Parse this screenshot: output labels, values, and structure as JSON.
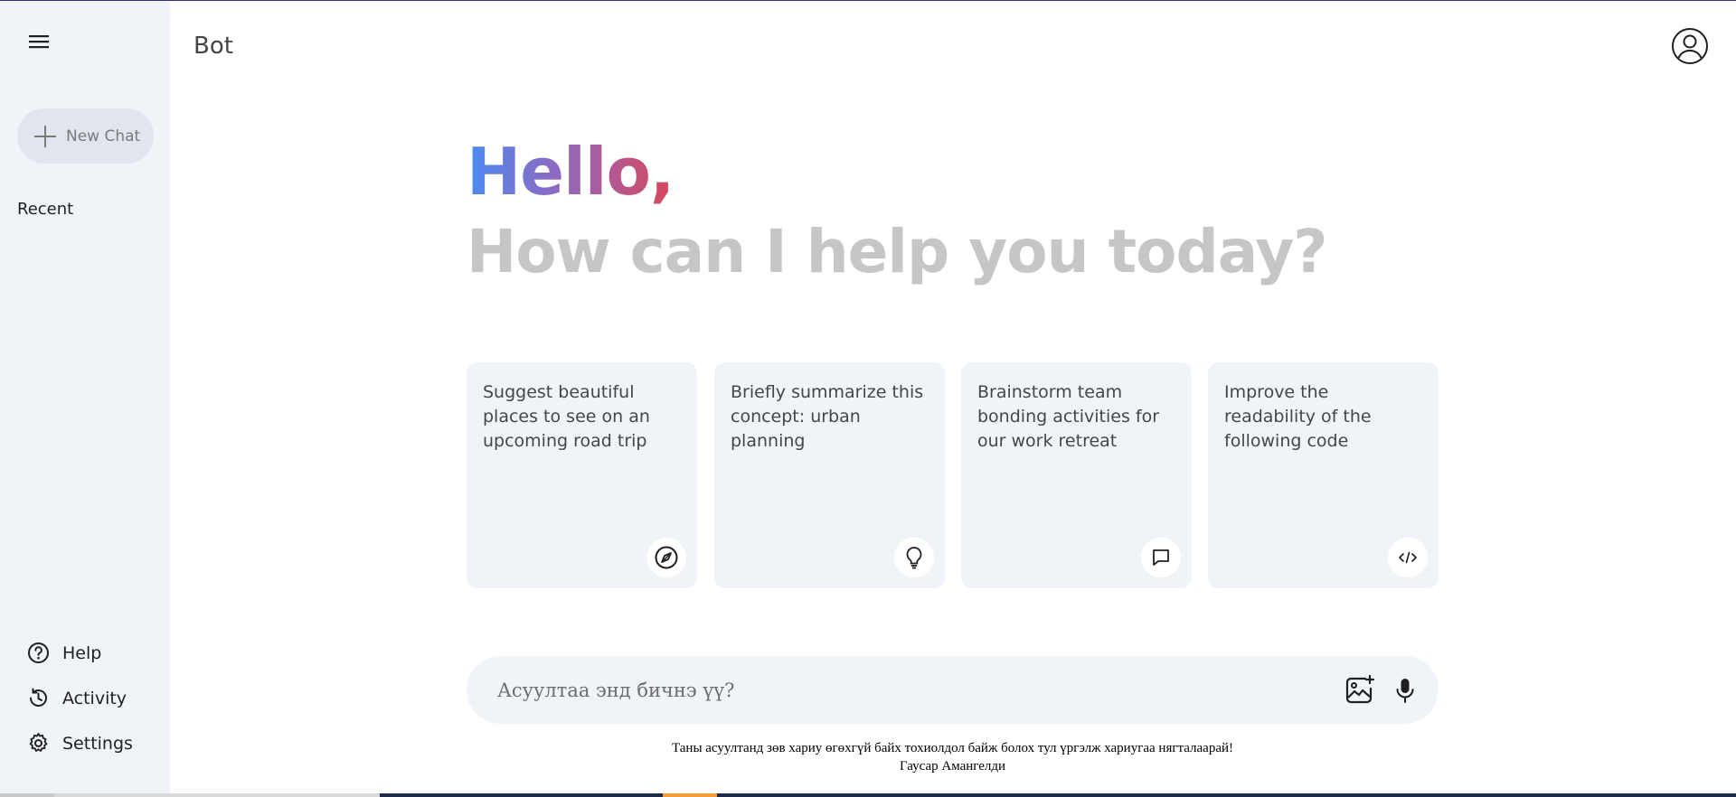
{
  "sidebar": {
    "new_chat_label": "New Chat",
    "recent_label": "Recent",
    "bottom_items": [
      {
        "label": "Help",
        "icon": "help-icon"
      },
      {
        "label": "Activity",
        "icon": "history-icon"
      },
      {
        "label": "Settings",
        "icon": "gear-icon"
      }
    ]
  },
  "header": {
    "brand": "Bot"
  },
  "greeting": {
    "hello": "Hello,",
    "subtitle": "How can I help you today?"
  },
  "cards": [
    {
      "text": "Suggest beautiful places to see on an upcoming road trip",
      "icon": "compass-icon"
    },
    {
      "text": "Briefly summarize this concept: urban planning",
      "icon": "lightbulb-icon"
    },
    {
      "text": "Brainstorm team bonding activities for our work retreat",
      "icon": "chat-bubble-icon"
    },
    {
      "text": "Improve the readability of the following code",
      "icon": "code-icon"
    }
  ],
  "input": {
    "placeholder": "Асуултаа энд бичнэ үү?",
    "value": ""
  },
  "footer": {
    "disclaimer": "Таны асуултанд зөв хариу өгөхгүй байх тохиолдол байж болох тул үргэлж хариугаа нягталаарай!",
    "author": "Гаусар Амангелди"
  },
  "colors": {
    "sidebar_bg": "#f0f4f9",
    "card_bg": "#f0f4f9",
    "gradient_start": "#4b8bf0",
    "gradient_end": "#d9465a",
    "subtitle": "#c4c7c5"
  }
}
